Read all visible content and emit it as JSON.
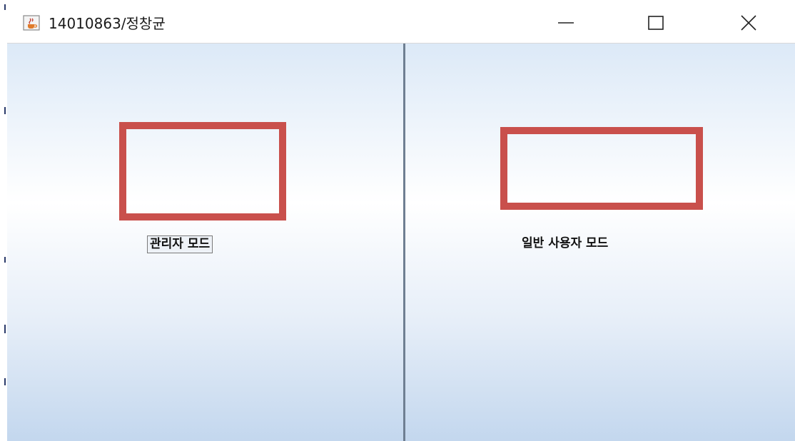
{
  "window": {
    "title": "14010863/정창균",
    "icon": "java-cup-icon",
    "controls": {
      "minimize_icon": "minimize-icon",
      "maximize_icon": "maximize-icon",
      "close_icon": "close-icon"
    }
  },
  "left_panel": {
    "admin_mode_label": "관리자 모드",
    "box_color": "#c9504c"
  },
  "right_panel": {
    "user_mode_label": "일반 사용자 모드",
    "box_color": "#c9504c"
  },
  "colors": {
    "panel_gradient_top": "#dce9f7",
    "panel_gradient_bottom": "#c3d7ee",
    "divider": "#6f7f92"
  }
}
